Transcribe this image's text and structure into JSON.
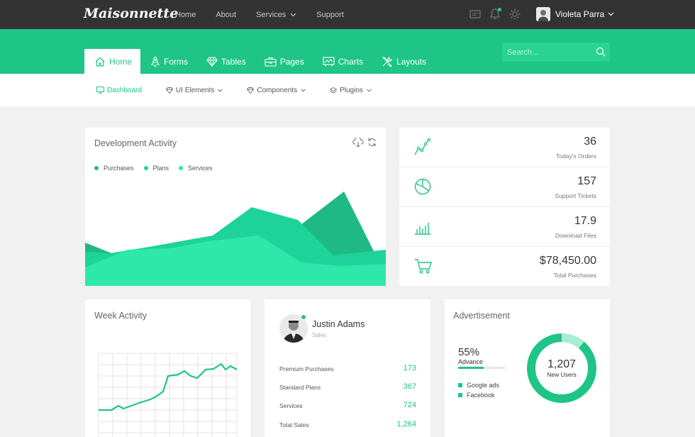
{
  "brand": {
    "logo": "Maisonnette",
    "accent": "#1fc487"
  },
  "topnav": {
    "items": [
      {
        "label": "Home"
      },
      {
        "label": "About"
      },
      {
        "label": "Services",
        "dropdown": true
      },
      {
        "label": "Support"
      }
    ],
    "icons": [
      "chat-icon",
      "bell-icon",
      "gear-icon"
    ],
    "user": {
      "name": "Violeta Parra"
    }
  },
  "tabs": [
    {
      "label": "Home",
      "icon": "home-icon",
      "active": true
    },
    {
      "label": "Forms",
      "icon": "rocket-icon"
    },
    {
      "label": "Tables",
      "icon": "diamond-icon"
    },
    {
      "label": "Pages",
      "icon": "briefcase-icon"
    },
    {
      "label": "Charts",
      "icon": "chart-icon"
    },
    {
      "label": "Layouts",
      "icon": "tools-icon"
    }
  ],
  "search": {
    "placeholder": "Search..."
  },
  "subnav": [
    {
      "label": "Dashboard",
      "active": true
    },
    {
      "label": "UI Elements"
    },
    {
      "label": "Components"
    },
    {
      "label": "Plugins"
    }
  ],
  "dev_activity": {
    "title": "Development Activity",
    "legend": [
      {
        "name": "Purchases",
        "color": "#1fb985"
      },
      {
        "name": "Plans",
        "color": "#1ed39a"
      },
      {
        "name": "Services",
        "color": "#2ee8a9"
      }
    ]
  },
  "stats": [
    {
      "value": "36",
      "label": "Today's Orders",
      "icon": "trend-icon"
    },
    {
      "value": "157",
      "label": "Support Tickets",
      "icon": "pie-icon"
    },
    {
      "value": "17.9",
      "label": "Download Files",
      "icon": "bar-chart-icon"
    },
    {
      "value": "$78,450.00",
      "label": "Total Purchases",
      "icon": "cart-icon"
    }
  ],
  "week_activity": {
    "title": "Week Activity"
  },
  "person": {
    "name": "Justin Adams",
    "role": "Sales",
    "rows": [
      {
        "label": "Premium Purchases",
        "value": "173"
      },
      {
        "label": "Standard Plans",
        "value": "367"
      },
      {
        "label": "Services",
        "value": "724"
      },
      {
        "label": "Total Sales",
        "value": "1,264"
      }
    ]
  },
  "advertisement": {
    "title": "Advertisement",
    "advance_pct": "55%",
    "advance_label": "Advance",
    "advance_fraction": 0.55,
    "legend": [
      "Google ads",
      "Facebook"
    ],
    "donut_value": "1,207",
    "donut_label": "New Users"
  }
}
